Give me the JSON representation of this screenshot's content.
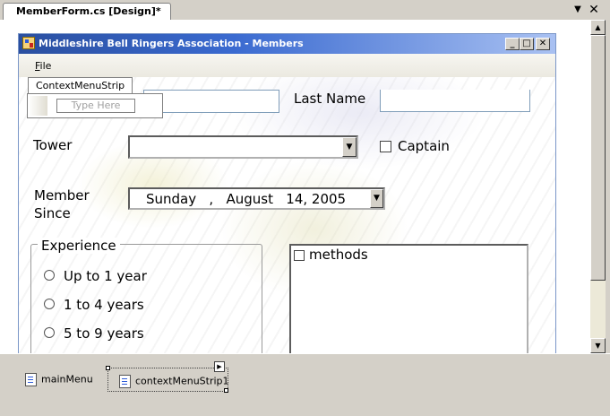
{
  "document_tab": {
    "title": "MemberForm.cs [Design]*"
  },
  "tab_controls": {
    "menu_glyph": "▼",
    "close_glyph": "✕"
  },
  "form": {
    "title": "Middleshire Bell Ringers Association - Members",
    "menu_file": "File",
    "accent": "#2a4fa0"
  },
  "context_menu_strip": {
    "tab_label": "ContextMenuStrip",
    "placeholder": "Type Here"
  },
  "fields": {
    "last_name_label": "Last Name",
    "tower_label": "Tower",
    "captain_label": "Captain",
    "member_since_line1": "Member",
    "member_since_line2": "Since",
    "member_since_date": "Sunday   ,   August   14, 2005"
  },
  "experience": {
    "title": "Experience",
    "options": [
      "Up to 1 year",
      "1 to 4 years",
      "5 to 9 years"
    ]
  },
  "methods": {
    "label": "methods"
  },
  "tray": {
    "main_menu": "mainMenu",
    "context_menu": "contextMenuStrip1"
  }
}
